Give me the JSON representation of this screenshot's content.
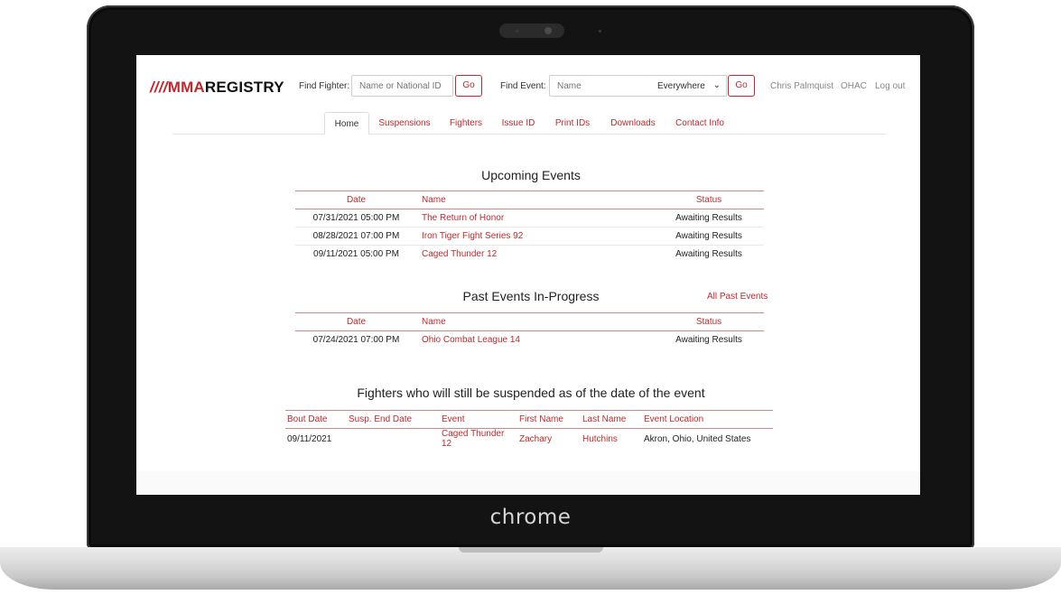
{
  "device": {
    "brand": "chrome"
  },
  "header": {
    "logo_stripes": "////",
    "logo_mma": "MMA",
    "logo_registry": "REGISTRY",
    "find_fighter_label": "Find Fighter:",
    "find_fighter_placeholder": "Name or National ID",
    "go_label": "Go",
    "find_event_label": "Find Event:",
    "find_event_placeholder": "Name",
    "scope_selected": "Everywhere",
    "user_name": "Chris Palmquist",
    "org": "OHAC",
    "logout": "Log out"
  },
  "tabs": [
    "Home",
    "Suspensions",
    "Fighters",
    "Issue ID",
    "Print IDs",
    "Downloads",
    "Contact Info"
  ],
  "upcoming": {
    "title": "Upcoming Events",
    "headers": [
      "Date",
      "Name",
      "Status"
    ],
    "rows": [
      {
        "date": "07/31/2021 05:00 PM",
        "name": "The Return of Honor",
        "status": "Awaiting Results"
      },
      {
        "date": "08/28/2021 07:00 PM",
        "name": "Iron Tiger Fight Series 92",
        "status": "Awaiting Results"
      },
      {
        "date": "09/11/2021 05:00 PM",
        "name": "Caged Thunder 12",
        "status": "Awaiting Results"
      }
    ]
  },
  "past": {
    "title": "Past Events In-Progress",
    "all_link": "All Past Events",
    "headers": [
      "Date",
      "Name",
      "Status"
    ],
    "rows": [
      {
        "date": "07/24/2021 07:00 PM",
        "name": "Ohio Combat League 14",
        "status": "Awaiting Results"
      }
    ]
  },
  "suspended": {
    "title": "Fighters who will still be suspended as of the date of the event",
    "headers": [
      "Bout Date",
      "Susp. End Date",
      "Event",
      "First Name",
      "Last Name",
      "Event Location"
    ],
    "rows": [
      {
        "bout_date": "09/11/2021",
        "susp_end": "",
        "event": "Caged Thunder 12",
        "first": "Zachary",
        "last": "Hutchins",
        "location": "Akron, Ohio, United States"
      }
    ]
  },
  "colors": {
    "accent": "#c0282e",
    "bezel": "#131313"
  }
}
